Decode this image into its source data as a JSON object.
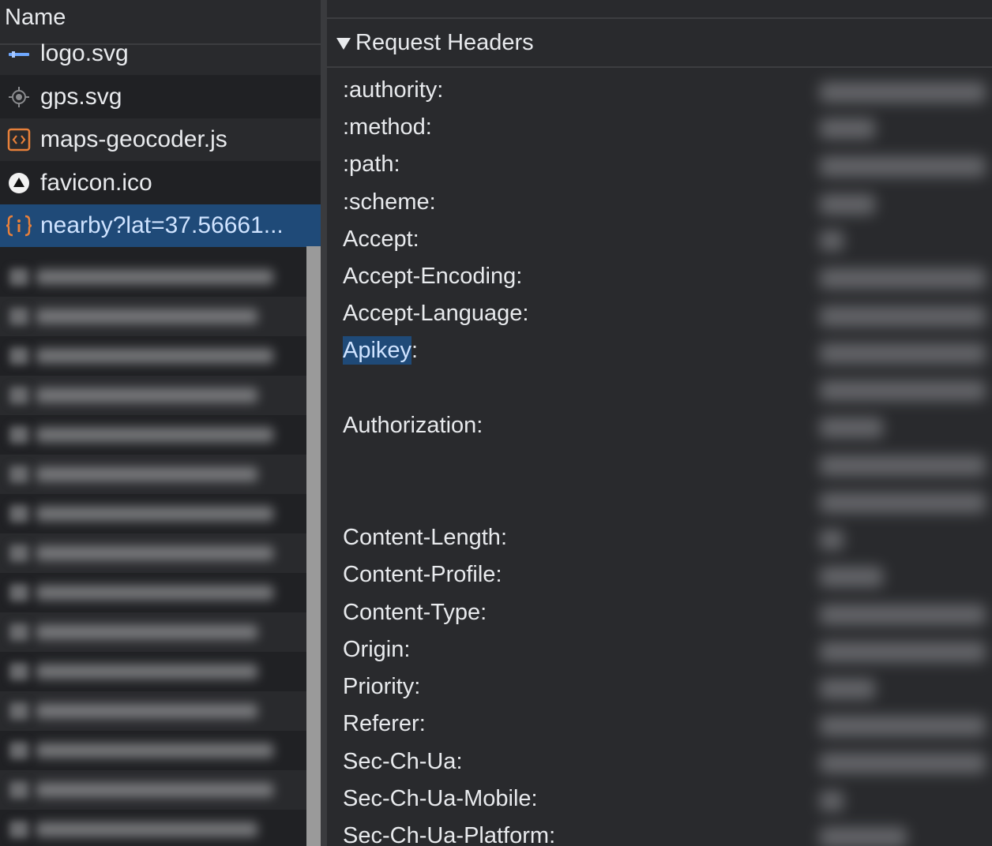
{
  "list": {
    "column_header": "Name",
    "items": [
      {
        "name": "logo.svg",
        "icon": "logo-image-icon"
      },
      {
        "name": "gps.svg",
        "icon": "gps-crosshair-icon"
      },
      {
        "name": "maps-geocoder.js",
        "icon": "script-file-icon"
      },
      {
        "name": "favicon.ico",
        "icon": "favicon-icon"
      },
      {
        "name": "nearby?lat=37.56661...",
        "icon": "json-fetch-icon",
        "selected": true
      }
    ],
    "selected_color": "#1f4a78"
  },
  "panel": {
    "section_title": "Request Headers",
    "headers": [
      {
        "key": ":authority",
        "sep": ":"
      },
      {
        "key": ":method",
        "sep": ":"
      },
      {
        "key": ":path",
        "sep": ":"
      },
      {
        "key": ":scheme",
        "sep": ":"
      },
      {
        "key": "Accept",
        "sep": ":"
      },
      {
        "key": "Accept-Encoding",
        "sep": ":"
      },
      {
        "key": "Accept-Language",
        "sep": ":"
      },
      {
        "key": "Apikey",
        "sep": ":",
        "highlighted": true
      },
      {
        "key": "Authorization",
        "sep": ":"
      },
      {
        "key": "Content-Length",
        "sep": ":"
      },
      {
        "key": "Content-Profile",
        "sep": ":"
      },
      {
        "key": "Content-Type",
        "sep": ":"
      },
      {
        "key": "Origin",
        "sep": ":"
      },
      {
        "key": "Priority",
        "sep": ":"
      },
      {
        "key": "Referer",
        "sep": ":"
      },
      {
        "key": "Sec-Ch-Ua",
        "sep": ":"
      },
      {
        "key": "Sec-Ch-Ua-Mobile",
        "sep": ":"
      },
      {
        "key": "Sec-Ch-Ua-Platform",
        "sep": ":"
      }
    ],
    "values_redacted": true
  },
  "colors": {
    "background": "#292a2d",
    "list_background": "#202124",
    "text": "#e8eaed",
    "selection": "#1f4a78",
    "script_icon": "#e8803a"
  }
}
